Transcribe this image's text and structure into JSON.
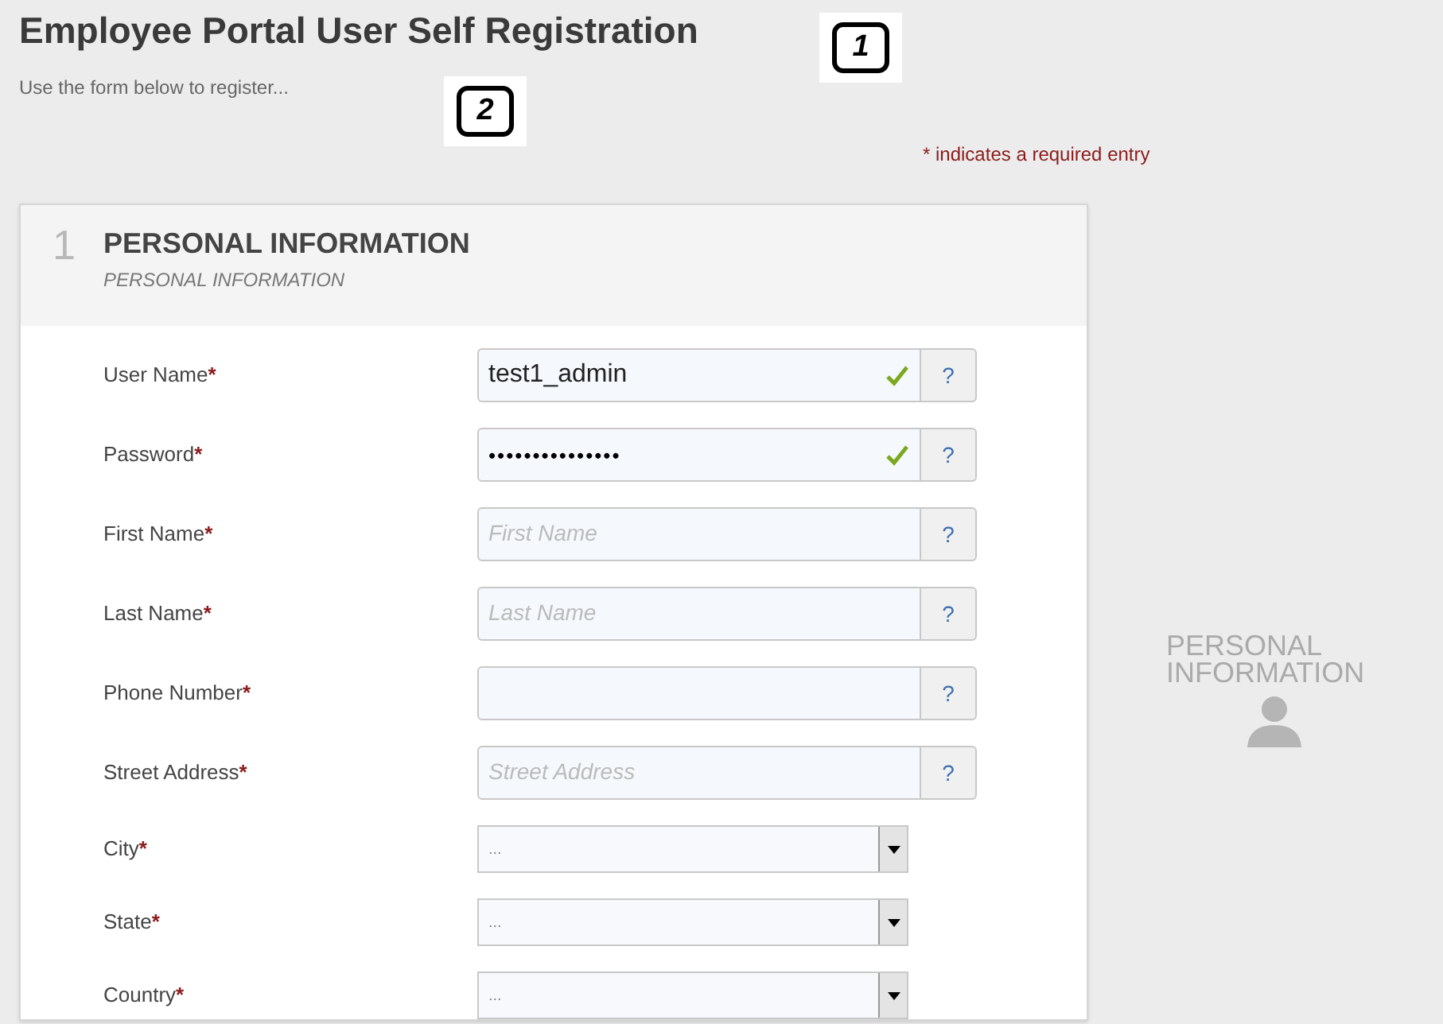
{
  "title": "Employee Portal User Self Registration",
  "subtitle": "Use the form below to register...",
  "callouts": [
    "1",
    "2"
  ],
  "required_note": "* indicates a required entry",
  "section": {
    "number": "1",
    "title": "PERSONAL INFORMATION",
    "subtitle": "PERSONAL INFORMATION",
    "fields": [
      {
        "kind": "text",
        "label": "User Name",
        "required_mark": "*",
        "value": "test1_admin",
        "valid": true,
        "help": "?"
      },
      {
        "kind": "password",
        "label": "Password",
        "required_mark": "*",
        "value": "•••••••••••••••",
        "valid": true,
        "help": "?"
      },
      {
        "kind": "text",
        "label": "First Name",
        "required_mark": "*",
        "placeholder": "First Name",
        "valid": false,
        "help": "?"
      },
      {
        "kind": "text",
        "label": "Last Name",
        "required_mark": "*",
        "placeholder": "Last Name",
        "valid": false,
        "help": "?"
      },
      {
        "kind": "text",
        "label": "Phone Number",
        "required_mark": "*",
        "valid": false,
        "help": "?"
      },
      {
        "kind": "text",
        "label": "Street Address",
        "required_mark": "*",
        "placeholder": "Street Address",
        "valid": false,
        "help": "?"
      },
      {
        "kind": "select",
        "label": "City",
        "required_mark": "*",
        "value": "..."
      },
      {
        "kind": "select",
        "label": "State",
        "required_mark": "*",
        "value": "..."
      },
      {
        "kind": "select",
        "label": "Country",
        "required_mark": "*",
        "value": "..."
      }
    ]
  },
  "side_panel": {
    "title": "PERSONAL INFORMATION"
  }
}
